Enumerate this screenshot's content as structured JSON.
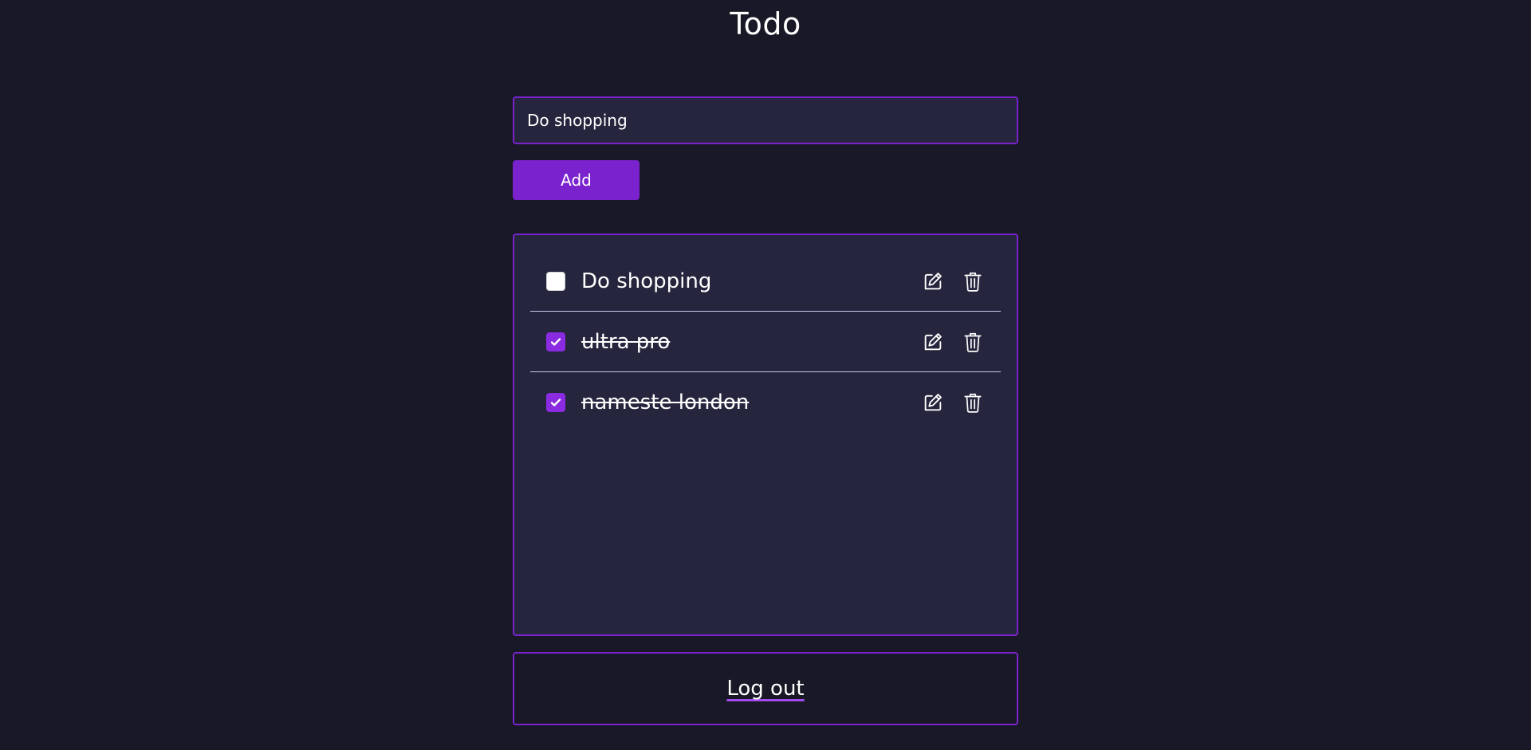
{
  "page": {
    "title": "Todo"
  },
  "form": {
    "input_value": "Do shopping",
    "add_label": "Add"
  },
  "todos": [
    {
      "text": "Do shopping",
      "done": false
    },
    {
      "text": "ultra pro",
      "done": true
    },
    {
      "text": "nameste london",
      "done": true
    }
  ],
  "icons": {
    "edit": "edit-icon",
    "delete": "trash-icon",
    "check": "check-icon"
  },
  "footer": {
    "logout_label": "Log out"
  },
  "colors": {
    "background": "#181826",
    "panel": "#25263e",
    "accent": "#7b22cf",
    "checkbox_checked": "#8a2be2",
    "divider": "#c9c4e8"
  }
}
